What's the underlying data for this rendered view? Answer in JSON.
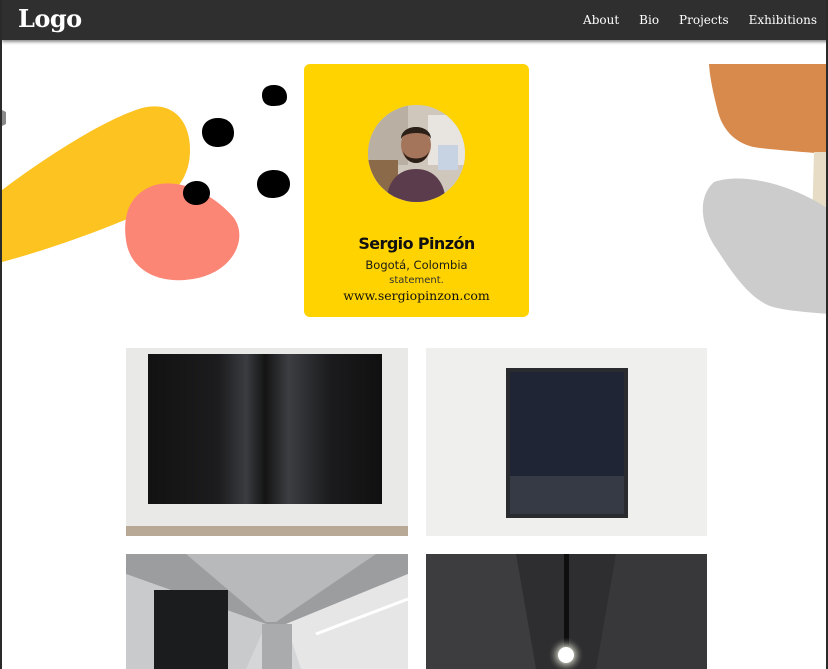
{
  "header": {
    "logo": "Logo",
    "nav": [
      {
        "label": "About"
      },
      {
        "label": "Bio"
      },
      {
        "label": "Projects"
      },
      {
        "label": "Exhibitions"
      }
    ]
  },
  "profile": {
    "name": "Sergio Pinzón",
    "location": "Bogotá, Colombia",
    "statement": "statement.",
    "website": "www.sergiopinzon.com"
  },
  "colors": {
    "navbar": "#2f2f2f",
    "card": "#ffd300",
    "yellow_shape": "#fcc321",
    "pink_shape": "#fc8676",
    "orange_shape": "#d88a4d",
    "gray_shape": "#cccccc",
    "dots": "#000000"
  },
  "gallery": {
    "items": [
      {
        "subject": "large dark diptych painting on white wall"
      },
      {
        "subject": "framed dark blue painting on white wall"
      },
      {
        "subject": "gallery corridor with skylight and dark painting"
      },
      {
        "subject": "dark room with hanging light bulb"
      }
    ]
  }
}
